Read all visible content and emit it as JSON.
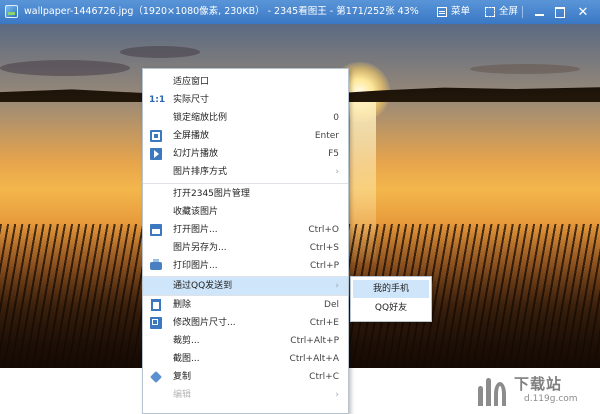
{
  "window": {
    "title": "wallpaper-1446726.jpg（1920×1080像素, 230KB） - 2345看图王 - 第171/252张 43%",
    "menu_label": "菜单",
    "fullscreen_label": "全屏",
    "minimize_glyph": "",
    "maximize_glyph": "",
    "close_glyph": "✕"
  },
  "context_menu": {
    "items": [
      {
        "label": "适应窗口",
        "shortcut": "",
        "icon": ""
      },
      {
        "label": "实际尺寸",
        "shortcut": "",
        "icon": "1:1"
      },
      {
        "label": "锁定缩放比例",
        "shortcut": "0",
        "icon": ""
      },
      {
        "label": "全屏播放",
        "shortcut": "Enter",
        "icon": "fullscreen-icon"
      },
      {
        "label": "幻灯片播放",
        "shortcut": "F5",
        "icon": "slideshow-icon"
      },
      {
        "label": "图片排序方式",
        "shortcut": "›",
        "icon": ""
      },
      {
        "label": "打开2345图片管理",
        "shortcut": "",
        "icon": ""
      },
      {
        "label": "收藏该图片",
        "shortcut": "",
        "icon": ""
      },
      {
        "label": "打开图片...",
        "shortcut": "Ctrl+O",
        "icon": "open-icon"
      },
      {
        "label": "图片另存为...",
        "shortcut": "Ctrl+S",
        "icon": ""
      },
      {
        "label": "打印图片...",
        "shortcut": "Ctrl+P",
        "icon": "print-icon"
      },
      {
        "label": "通过QQ发送到",
        "shortcut": "›",
        "icon": ""
      },
      {
        "label": "删除",
        "shortcut": "Del",
        "icon": "trash-icon"
      },
      {
        "label": "修改图片尺寸...",
        "shortcut": "Ctrl+E",
        "icon": "resize-icon"
      },
      {
        "label": "裁剪...",
        "shortcut": "Ctrl+Alt+P",
        "icon": ""
      },
      {
        "label": "截图...",
        "shortcut": "Ctrl+Alt+A",
        "icon": ""
      },
      {
        "label": "复制",
        "shortcut": "Ctrl+C",
        "icon": "copy-icon"
      },
      {
        "label": "编辑",
        "shortcut": "›",
        "icon": ""
      }
    ]
  },
  "submenu": {
    "items": [
      {
        "label": "我的手机"
      },
      {
        "label": "QQ好友"
      }
    ]
  },
  "watermark": {
    "brand": "下载站",
    "site": "d.119g.com"
  },
  "colors": {
    "titlebar": "#3a78c4",
    "highlight": "#cfe6fa",
    "icon_blue": "#3b78c0"
  }
}
